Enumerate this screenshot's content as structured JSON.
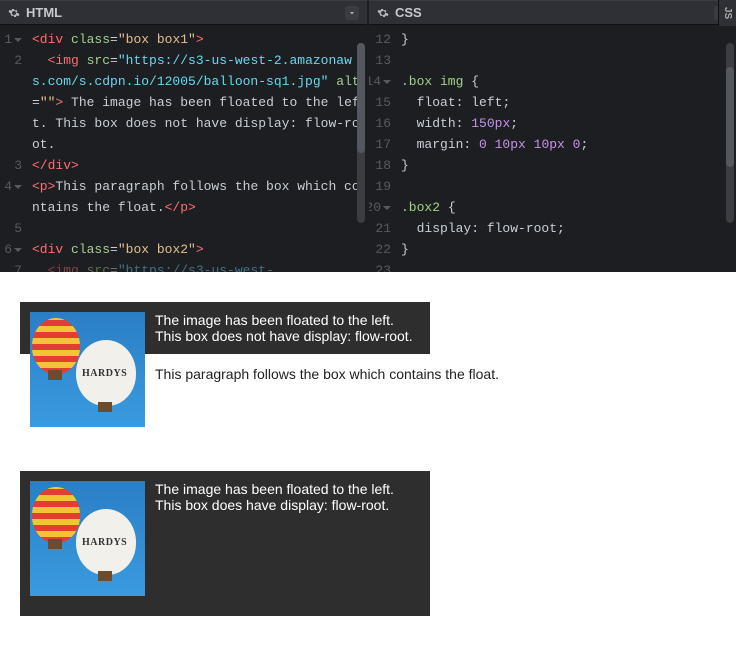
{
  "panels": {
    "html": {
      "title": "HTML"
    },
    "css": {
      "title": "CSS"
    },
    "js": {
      "label": "JS"
    }
  },
  "html_code": {
    "gutter": [
      {
        "n": "1",
        "arrow": true
      },
      {
        "n": "2",
        "arrow": false
      },
      {
        "n": "",
        "arrow": false
      },
      {
        "n": "",
        "arrow": false
      },
      {
        "n": "",
        "arrow": false
      },
      {
        "n": "",
        "arrow": false
      },
      {
        "n": "3",
        "arrow": false
      },
      {
        "n": "4",
        "arrow": true
      },
      {
        "n": "",
        "arrow": false
      },
      {
        "n": "5",
        "arrow": false
      },
      {
        "n": "6",
        "arrow": true
      },
      {
        "n": "7",
        "arrow": false
      }
    ],
    "l1": {
      "open": "<div ",
      "cls": "class",
      "eq": "=",
      "val": "\"box box1\"",
      "close": ">"
    },
    "l2": {
      "indent": "  ",
      "open": "<img ",
      "a1": "src",
      "eq": "=",
      "url": "\"https://s3-us-west-2.amazonaws.com/s.cdpn.io/12005/balloon-sq1.jpg\"",
      "sp": " ",
      "a2": "alt",
      "val2": "\"\"",
      "close": "> ",
      "txt": "The image has been floated to the left. This box does not have display: flow-root."
    },
    "l3": {
      "close": "</div>"
    },
    "l4": {
      "open": "<p>",
      "txt": "This paragraph follows the box which contains the float.",
      "close": "</p>"
    },
    "l5": "",
    "l6": {
      "open": "<div ",
      "cls": "class",
      "eq": "=",
      "val": "\"box box2\"",
      "close": ">"
    },
    "l7": {
      "indent": "  ",
      "partial": "<img ",
      "a1": "src",
      "eq": "=",
      "url": "\"https://s3-us-west-"
    }
  },
  "css_code": {
    "gutter": [
      {
        "n": "12",
        "arrow": false
      },
      {
        "n": "13",
        "arrow": false
      },
      {
        "n": "14",
        "arrow": true
      },
      {
        "n": "15",
        "arrow": false
      },
      {
        "n": "16",
        "arrow": false
      },
      {
        "n": "17",
        "arrow": false
      },
      {
        "n": "18",
        "arrow": false
      },
      {
        "n": "19",
        "arrow": false
      },
      {
        "n": "20",
        "arrow": true
      },
      {
        "n": "21",
        "arrow": false
      },
      {
        "n": "22",
        "arrow": false
      },
      {
        "n": "23",
        "arrow": false
      }
    ],
    "l12": "}",
    "l14": {
      "sel": ".box img ",
      "brace": "{"
    },
    "l15": {
      "pad": "  ",
      "prop": "float",
      "colon": ": ",
      "val": "left",
      "semi": ";"
    },
    "l16": {
      "pad": "  ",
      "prop": "width",
      "colon": ": ",
      "num": "150px",
      "semi": ";"
    },
    "l17": {
      "pad": "  ",
      "prop": "margin",
      "colon": ": ",
      "num": "0 10px 10px 0",
      "semi": ";"
    },
    "l18": "}",
    "l20": {
      "sel": ".box2 ",
      "brace": "{"
    },
    "l21": {
      "pad": "  ",
      "prop": "display",
      "colon": ": ",
      "val": "flow-root",
      "semi": ";"
    },
    "l22": "}"
  },
  "preview": {
    "box1_text": "The image has been floated to the left. This box does not have display: flow-root.",
    "follow_p": "This paragraph follows the box which contains the float.",
    "box2_text": "The image has been floated to the left. This box does have display: flow-root."
  }
}
